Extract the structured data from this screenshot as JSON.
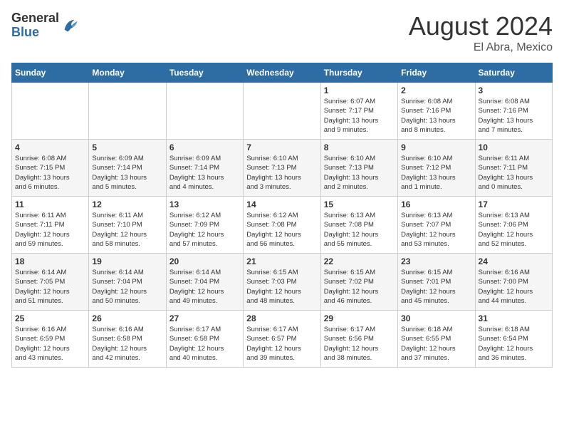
{
  "header": {
    "logo_general": "General",
    "logo_blue": "Blue",
    "month_year": "August 2024",
    "location": "El Abra, Mexico"
  },
  "calendar": {
    "days_of_week": [
      "Sunday",
      "Monday",
      "Tuesday",
      "Wednesday",
      "Thursday",
      "Friday",
      "Saturday"
    ],
    "weeks": [
      [
        {
          "day": "",
          "info": ""
        },
        {
          "day": "",
          "info": ""
        },
        {
          "day": "",
          "info": ""
        },
        {
          "day": "",
          "info": ""
        },
        {
          "day": "1",
          "info": "Sunrise: 6:07 AM\nSunset: 7:17 PM\nDaylight: 13 hours\nand 9 minutes."
        },
        {
          "day": "2",
          "info": "Sunrise: 6:08 AM\nSunset: 7:16 PM\nDaylight: 13 hours\nand 8 minutes."
        },
        {
          "day": "3",
          "info": "Sunrise: 6:08 AM\nSunset: 7:16 PM\nDaylight: 13 hours\nand 7 minutes."
        }
      ],
      [
        {
          "day": "4",
          "info": "Sunrise: 6:08 AM\nSunset: 7:15 PM\nDaylight: 13 hours\nand 6 minutes."
        },
        {
          "day": "5",
          "info": "Sunrise: 6:09 AM\nSunset: 7:14 PM\nDaylight: 13 hours\nand 5 minutes."
        },
        {
          "day": "6",
          "info": "Sunrise: 6:09 AM\nSunset: 7:14 PM\nDaylight: 13 hours\nand 4 minutes."
        },
        {
          "day": "7",
          "info": "Sunrise: 6:10 AM\nSunset: 7:13 PM\nDaylight: 13 hours\nand 3 minutes."
        },
        {
          "day": "8",
          "info": "Sunrise: 6:10 AM\nSunset: 7:13 PM\nDaylight: 13 hours\nand 2 minutes."
        },
        {
          "day": "9",
          "info": "Sunrise: 6:10 AM\nSunset: 7:12 PM\nDaylight: 13 hours\nand 1 minute."
        },
        {
          "day": "10",
          "info": "Sunrise: 6:11 AM\nSunset: 7:11 PM\nDaylight: 13 hours\nand 0 minutes."
        }
      ],
      [
        {
          "day": "11",
          "info": "Sunrise: 6:11 AM\nSunset: 7:11 PM\nDaylight: 12 hours\nand 59 minutes."
        },
        {
          "day": "12",
          "info": "Sunrise: 6:11 AM\nSunset: 7:10 PM\nDaylight: 12 hours\nand 58 minutes."
        },
        {
          "day": "13",
          "info": "Sunrise: 6:12 AM\nSunset: 7:09 PM\nDaylight: 12 hours\nand 57 minutes."
        },
        {
          "day": "14",
          "info": "Sunrise: 6:12 AM\nSunset: 7:08 PM\nDaylight: 12 hours\nand 56 minutes."
        },
        {
          "day": "15",
          "info": "Sunrise: 6:13 AM\nSunset: 7:08 PM\nDaylight: 12 hours\nand 55 minutes."
        },
        {
          "day": "16",
          "info": "Sunrise: 6:13 AM\nSunset: 7:07 PM\nDaylight: 12 hours\nand 53 minutes."
        },
        {
          "day": "17",
          "info": "Sunrise: 6:13 AM\nSunset: 7:06 PM\nDaylight: 12 hours\nand 52 minutes."
        }
      ],
      [
        {
          "day": "18",
          "info": "Sunrise: 6:14 AM\nSunset: 7:05 PM\nDaylight: 12 hours\nand 51 minutes."
        },
        {
          "day": "19",
          "info": "Sunrise: 6:14 AM\nSunset: 7:04 PM\nDaylight: 12 hours\nand 50 minutes."
        },
        {
          "day": "20",
          "info": "Sunrise: 6:14 AM\nSunset: 7:04 PM\nDaylight: 12 hours\nand 49 minutes."
        },
        {
          "day": "21",
          "info": "Sunrise: 6:15 AM\nSunset: 7:03 PM\nDaylight: 12 hours\nand 48 minutes."
        },
        {
          "day": "22",
          "info": "Sunrise: 6:15 AM\nSunset: 7:02 PM\nDaylight: 12 hours\nand 46 minutes."
        },
        {
          "day": "23",
          "info": "Sunrise: 6:15 AM\nSunset: 7:01 PM\nDaylight: 12 hours\nand 45 minutes."
        },
        {
          "day": "24",
          "info": "Sunrise: 6:16 AM\nSunset: 7:00 PM\nDaylight: 12 hours\nand 44 minutes."
        }
      ],
      [
        {
          "day": "25",
          "info": "Sunrise: 6:16 AM\nSunset: 6:59 PM\nDaylight: 12 hours\nand 43 minutes."
        },
        {
          "day": "26",
          "info": "Sunrise: 6:16 AM\nSunset: 6:58 PM\nDaylight: 12 hours\nand 42 minutes."
        },
        {
          "day": "27",
          "info": "Sunrise: 6:17 AM\nSunset: 6:58 PM\nDaylight: 12 hours\nand 40 minutes."
        },
        {
          "day": "28",
          "info": "Sunrise: 6:17 AM\nSunset: 6:57 PM\nDaylight: 12 hours\nand 39 minutes."
        },
        {
          "day": "29",
          "info": "Sunrise: 6:17 AM\nSunset: 6:56 PM\nDaylight: 12 hours\nand 38 minutes."
        },
        {
          "day": "30",
          "info": "Sunrise: 6:18 AM\nSunset: 6:55 PM\nDaylight: 12 hours\nand 37 minutes."
        },
        {
          "day": "31",
          "info": "Sunrise: 6:18 AM\nSunset: 6:54 PM\nDaylight: 12 hours\nand 36 minutes."
        }
      ]
    ]
  }
}
